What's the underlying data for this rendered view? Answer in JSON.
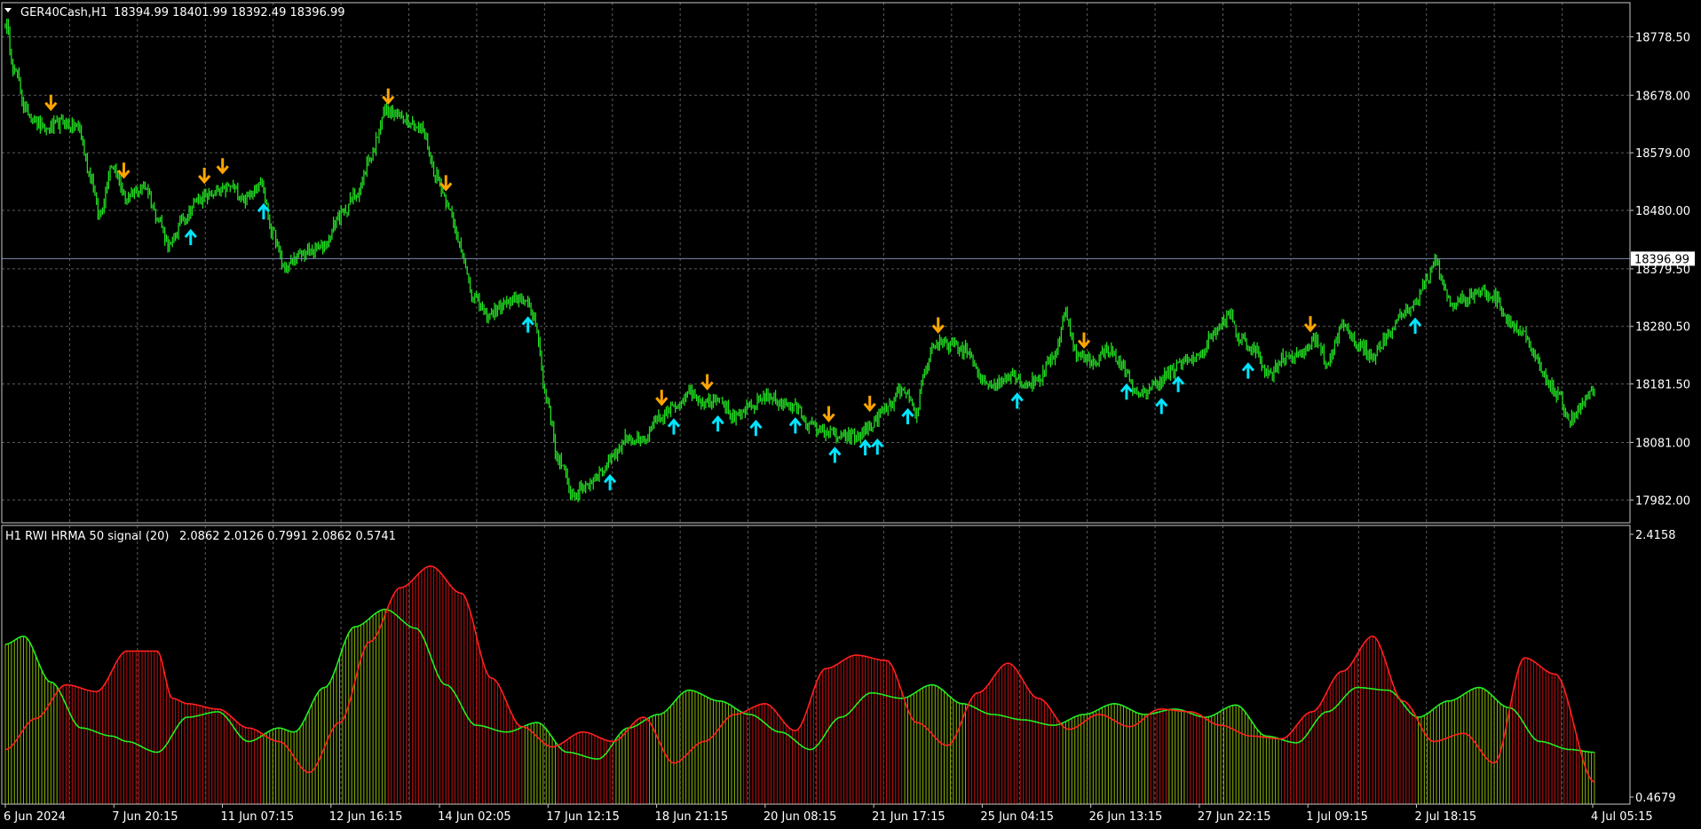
{
  "colors": {
    "background": "#000000",
    "grid": "#5a5a5a",
    "axis": "#c8c8c8",
    "candle": "#22dd22",
    "up_arrow": "#00e5ff",
    "down_arrow": "#ffa500",
    "current_price_line": "#7f8cb0",
    "signal_up_line": "#22ee22",
    "signal_down_line": "#ff2020",
    "hist_up": "#8db600",
    "hist_down": "#c01010"
  },
  "chart_data": [
    {
      "type": "candlestick",
      "header": {
        "symbol": "GER40Cash,H1",
        "ohlc": "18394.99 18401.99 18392.49 18396.99"
      },
      "y_ticks": [
        "18778.50",
        "18678.00",
        "18579.00",
        "18480.00",
        "18379.50",
        "18280.50",
        "18181.50",
        "18081.00",
        "17982.00"
      ],
      "y_tick_values": [
        18778.5,
        18678.0,
        18579.0,
        18480.0,
        18379.5,
        18280.5,
        18181.5,
        18081.0,
        17982.0
      ],
      "ylim": [
        17955,
        18825
      ],
      "current_price": 18396.99,
      "current_price_label": "18396.99",
      "close_path": [
        [
          0,
          18800
        ],
        [
          6,
          18720
        ],
        [
          14,
          18650
        ],
        [
          26,
          18620
        ],
        [
          38,
          18630
        ],
        [
          48,
          18622
        ],
        [
          56,
          18540
        ],
        [
          62,
          18470
        ],
        [
          70,
          18560
        ],
        [
          80,
          18500
        ],
        [
          92,
          18520
        ],
        [
          100,
          18470
        ],
        [
          108,
          18420
        ],
        [
          118,
          18470
        ],
        [
          128,
          18500
        ],
        [
          140,
          18510
        ],
        [
          148,
          18520
        ],
        [
          158,
          18500
        ],
        [
          168,
          18530
        ],
        [
          176,
          18440
        ],
        [
          184,
          18380
        ],
        [
          192,
          18400
        ],
        [
          200,
          18410
        ],
        [
          210,
          18420
        ],
        [
          220,
          18470
        ],
        [
          232,
          18510
        ],
        [
          240,
          18570
        ],
        [
          250,
          18650
        ],
        [
          262,
          18640
        ],
        [
          274,
          18620
        ],
        [
          284,
          18540
        ],
        [
          290,
          18500
        ],
        [
          298,
          18430
        ],
        [
          308,
          18330
        ],
        [
          318,
          18300
        ],
        [
          330,
          18320
        ],
        [
          340,
          18330
        ],
        [
          348,
          18300
        ],
        [
          356,
          18160
        ],
        [
          364,
          18050
        ],
        [
          374,
          17990
        ],
        [
          384,
          18010
        ],
        [
          392,
          18030
        ],
        [
          400,
          18060
        ],
        [
          410,
          18090
        ],
        [
          420,
          18080
        ],
        [
          430,
          18120
        ],
        [
          440,
          18140
        ],
        [
          450,
          18170
        ],
        [
          460,
          18150
        ],
        [
          470,
          18160
        ],
        [
          480,
          18120
        ],
        [
          490,
          18140
        ],
        [
          500,
          18160
        ],
        [
          510,
          18150
        ],
        [
          520,
          18140
        ],
        [
          530,
          18110
        ],
        [
          540,
          18100
        ],
        [
          550,
          18090
        ],
        [
          560,
          18090
        ],
        [
          570,
          18110
        ],
        [
          580,
          18140
        ],
        [
          590,
          18170
        ],
        [
          600,
          18130
        ],
        [
          604,
          18200
        ],
        [
          612,
          18250
        ],
        [
          622,
          18250
        ],
        [
          632,
          18240
        ],
        [
          642,
          18190
        ],
        [
          652,
          18180
        ],
        [
          662,
          18200
        ],
        [
          672,
          18180
        ],
        [
          680,
          18190
        ],
        [
          690,
          18230
        ],
        [
          698,
          18300
        ],
        [
          706,
          18230
        ],
        [
          716,
          18220
        ],
        [
          726,
          18240
        ],
        [
          736,
          18210
        ],
        [
          746,
          18160
        ],
        [
          756,
          18180
        ],
        [
          766,
          18200
        ],
        [
          776,
          18220
        ],
        [
          786,
          18230
        ],
        [
          796,
          18270
        ],
        [
          806,
          18300
        ],
        [
          812,
          18260
        ],
        [
          822,
          18240
        ],
        [
          832,
          18200
        ],
        [
          842,
          18230
        ],
        [
          852,
          18230
        ],
        [
          862,
          18260
        ],
        [
          870,
          18220
        ],
        [
          880,
          18280
        ],
        [
          890,
          18250
        ],
        [
          900,
          18230
        ],
        [
          910,
          18260
        ],
        [
          918,
          18300
        ],
        [
          928,
          18320
        ],
        [
          936,
          18360
        ],
        [
          942,
          18400
        ],
        [
          946,
          18350
        ],
        [
          952,
          18320
        ],
        [
          962,
          18330
        ],
        [
          970,
          18340
        ],
        [
          980,
          18330
        ],
        [
          990,
          18290
        ],
        [
          998,
          18270
        ],
        [
          1006,
          18230
        ],
        [
          1014,
          18190
        ],
        [
          1022,
          18160
        ],
        [
          1030,
          18120
        ],
        [
          1040,
          18150
        ],
        [
          1046,
          18170
        ]
      ],
      "up_arrows_index": [
        122,
        170,
        344,
        398,
        440,
        469,
        494,
        520,
        546,
        566,
        574,
        594,
        666,
        738,
        761,
        772,
        818,
        928
      ],
      "down_arrows_index": [
        30,
        78,
        131,
        143,
        252,
        290,
        432,
        462,
        542,
        569,
        614,
        710,
        859
      ]
    },
    {
      "type": "line",
      "header": {
        "label": "H1 RWI  HRMA 50  signal (20)",
        "values": "2.0862 2.0126 0.7991 2.0862 0.5741"
      },
      "y_ticks": [
        "2.4158",
        "0.4679"
      ],
      "y_tick_values": [
        2.4158,
        0.4679
      ],
      "ylim": [
        0.4679,
        2.4158
      ],
      "series": [
        {
          "role": "main",
          "x": [
            0,
            12,
            30,
            50,
            70,
            80,
            100,
            120,
            140,
            160,
            180,
            190,
            210,
            230,
            250,
            270,
            290,
            310,
            330,
            350,
            370,
            390,
            410,
            430,
            450,
            470,
            490,
            510,
            530,
            550,
            570,
            590,
            610,
            630,
            650,
            670,
            690,
            710,
            730,
            750,
            770,
            790,
            810,
            830,
            850,
            870,
            890,
            910,
            930,
            950,
            970,
            990,
            1010,
            1030,
            1046
          ],
          "values": [
            1.6,
            1.66,
            1.32,
            0.98,
            0.92,
            0.88,
            0.8,
            1.06,
            1.1,
            0.88,
            0.98,
            0.95,
            1.28,
            1.73,
            1.86,
            1.72,
            1.3,
            1.0,
            0.95,
            1.02,
            0.8,
            0.75,
            0.98,
            1.08,
            1.26,
            1.18,
            1.08,
            0.95,
            0.82,
            1.06,
            1.24,
            1.2,
            1.3,
            1.16,
            1.08,
            1.04,
            1.0,
            1.08,
            1.16,
            1.08,
            1.12,
            1.06,
            1.15,
            0.92,
            0.87,
            1.1,
            1.28,
            1.26,
            1.06,
            1.18,
            1.28,
            1.13,
            0.88,
            0.82,
            0.8
          ]
        },
        {
          "role": "signal",
          "x": [
            0,
            20,
            40,
            60,
            80,
            100,
            110,
            120,
            140,
            160,
            180,
            200,
            220,
            240,
            260,
            280,
            300,
            320,
            340,
            360,
            380,
            400,
            420,
            440,
            460,
            480,
            500,
            520,
            540,
            560,
            580,
            600,
            620,
            640,
            660,
            680,
            700,
            720,
            740,
            760,
            780,
            800,
            820,
            840,
            860,
            880,
            900,
            920,
            940,
            960,
            980,
            1000,
            1020,
            1046
          ],
          "values": [
            0.82,
            1.05,
            1.3,
            1.25,
            1.55,
            1.55,
            1.2,
            1.16,
            1.12,
            0.98,
            0.88,
            0.65,
            1.02,
            1.62,
            2.02,
            2.18,
            1.98,
            1.35,
            0.99,
            0.84,
            0.95,
            0.88,
            1.06,
            0.72,
            0.88,
            1.08,
            1.16,
            0.96,
            1.42,
            1.52,
            1.48,
            1.02,
            0.85,
            1.24,
            1.46,
            1.2,
            0.97,
            1.08,
            0.99,
            1.12,
            1.1,
            1.0,
            0.92,
            0.9,
            1.1,
            1.4,
            1.66,
            1.18,
            0.88,
            0.94,
            0.72,
            1.5,
            1.38,
            0.58
          ]
        }
      ]
    }
  ],
  "x_axis_labels": [
    "6 Jun 2024",
    "7 Jun 20:15",
    "11 Jun 07:15",
    "12 Jun 16:15",
    "14 Jun 02:05",
    "17 Jun 12:15",
    "18 Jun 21:15",
    "20 Jun 08:15",
    "21 Jun 17:15",
    "25 Jun 04:15",
    "26 Jun 13:15",
    "27 Jun 22:15",
    "1 Jul 09:15",
    "2 Jul 18:15",
    "4 Jul 05:15"
  ]
}
